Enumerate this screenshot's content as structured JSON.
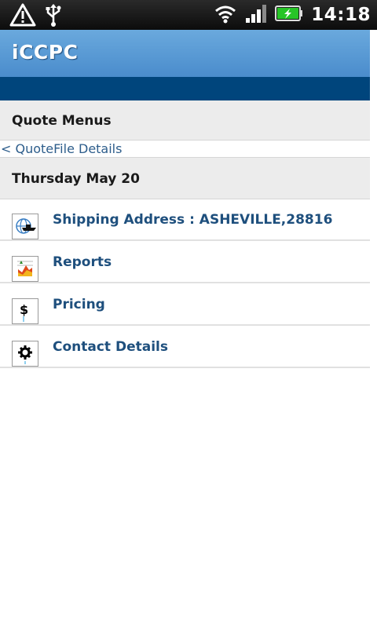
{
  "status": {
    "time": "14:18",
    "icons": [
      "warning-icon",
      "usb-icon",
      "wifi-icon",
      "signal-icon",
      "battery-charging-icon"
    ]
  },
  "app": {
    "title": "iCCPC"
  },
  "section": {
    "title": "Quote Menus"
  },
  "back": {
    "label": "< QuoteFile Details"
  },
  "date": {
    "label": "Thursday May 20"
  },
  "menu": [
    {
      "label": "Shipping Address : ASHEVILLE,28816",
      "icon": "ship-globe-icon"
    },
    {
      "label": "Reports",
      "icon": "report-chart-icon"
    },
    {
      "label": "Pricing",
      "icon": "dollar-icon"
    },
    {
      "label": "Contact Details",
      "icon": "gear-icon"
    }
  ],
  "colors": {
    "header": "#5a9ad6",
    "nav_band": "#00457c",
    "link": "#1e4f7d",
    "section_bg": "#ececec"
  }
}
